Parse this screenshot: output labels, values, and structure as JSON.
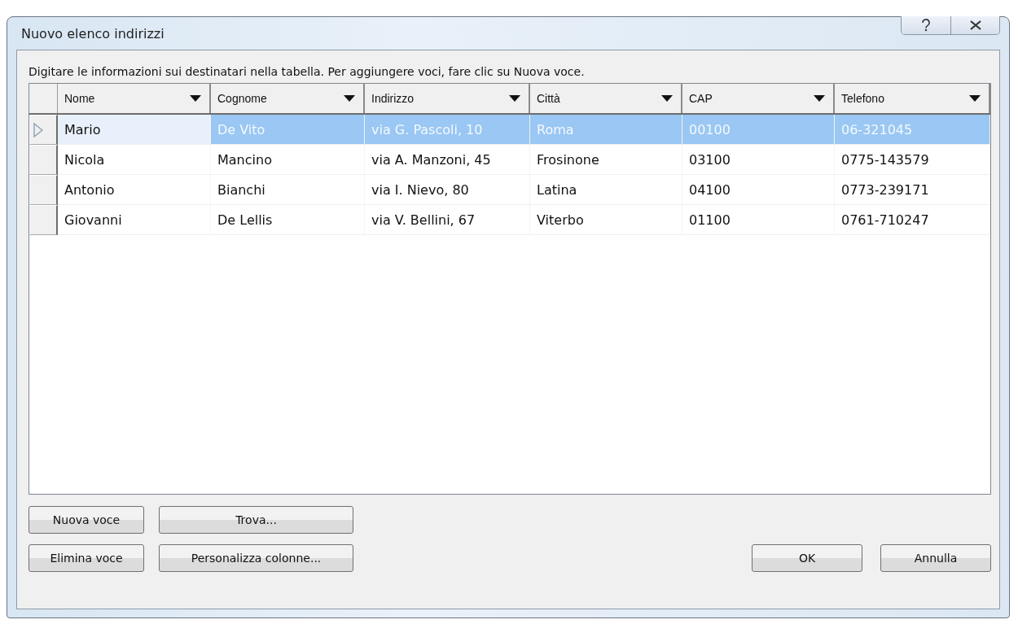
{
  "window": {
    "title": "Nuovo elenco indirizzi"
  },
  "instructions": "Digitare le informazioni sui destinatari nella tabella. Per aggiungere voci, fare clic su Nuova voce.",
  "table": {
    "columns": [
      "Nome",
      "Cognome",
      "Indirizzo",
      "Città",
      "CAP",
      "Telefono"
    ],
    "rows": [
      {
        "selected": true,
        "cells": [
          "Mario",
          "De Vito",
          "via G. Pascoli, 10",
          "Roma",
          "00100",
          "06-321045"
        ]
      },
      {
        "selected": false,
        "cells": [
          "Nicola",
          "Mancino",
          "via A. Manzoni, 45",
          "Frosinone",
          "03100",
          "0775-143579"
        ]
      },
      {
        "selected": false,
        "cells": [
          "Antonio",
          "Bianchi",
          "via I. Nievo, 80",
          "Latina",
          "04100",
          "0773-239171"
        ]
      },
      {
        "selected": false,
        "cells": [
          "Giovanni",
          "De Lellis",
          "via V. Bellini, 67",
          "Viterbo",
          "01100",
          "0761-710247"
        ]
      }
    ]
  },
  "left_buttons": [
    [
      "Nuova voce",
      "Trova..."
    ],
    [
      "Elimina voce",
      "Personalizza colonne..."
    ]
  ],
  "right_buttons": [
    "OK",
    "Annulla"
  ]
}
